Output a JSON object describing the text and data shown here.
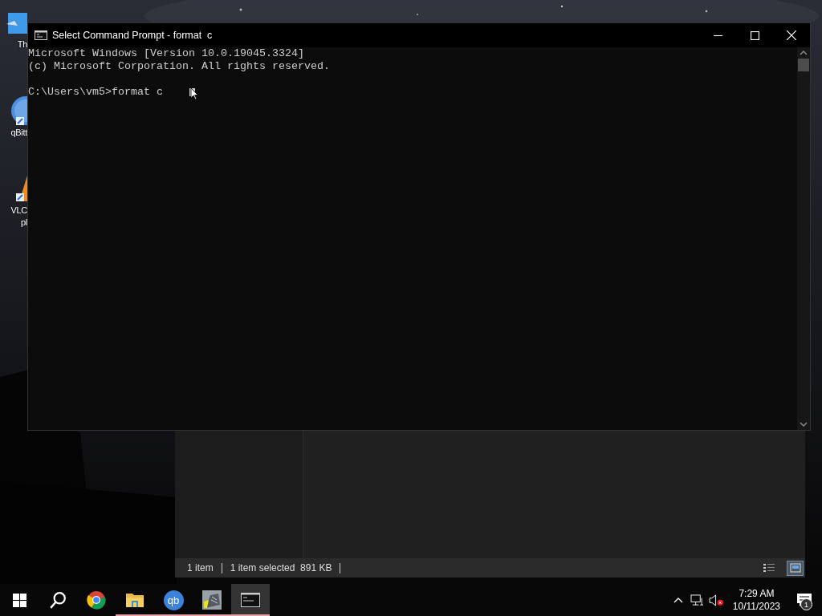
{
  "desktop": {
    "icons": [
      {
        "kind": "folder",
        "lines": [
          "Th"
        ]
      },
      {
        "kind": "qbittorrent",
        "lines": [
          "qBitt"
        ]
      },
      {
        "kind": "vlc",
        "lines": [
          "VLC",
          "pl"
        ]
      }
    ]
  },
  "explorer": {
    "status_items": [
      "1 item",
      "1 item selected  891 KB"
    ],
    "views": [
      {
        "kind": "details",
        "selected": false
      },
      {
        "kind": "large",
        "selected": true
      }
    ]
  },
  "console": {
    "title": "Select Command Prompt - format  c",
    "banner": [
      "Microsoft Windows [Version 10.0.19045.3324]",
      "(c) Microsoft Corporation. All rights reserved."
    ],
    "prompt": "C:\\Users\\vm5>format c"
  },
  "taskbar": {
    "apps": [
      {
        "kind": "chrome",
        "running": false,
        "selected": false
      },
      {
        "kind": "explorer",
        "running": true,
        "selected": false
      },
      {
        "kind": "qbittorrent",
        "text": "qb",
        "running": true,
        "selected": false
      },
      {
        "kind": "app",
        "running": true,
        "selected": false
      },
      {
        "kind": "console",
        "running": true,
        "selected": true
      }
    ],
    "time": "7:29 AM",
    "date": "10/11/2023",
    "notifications": "1"
  }
}
